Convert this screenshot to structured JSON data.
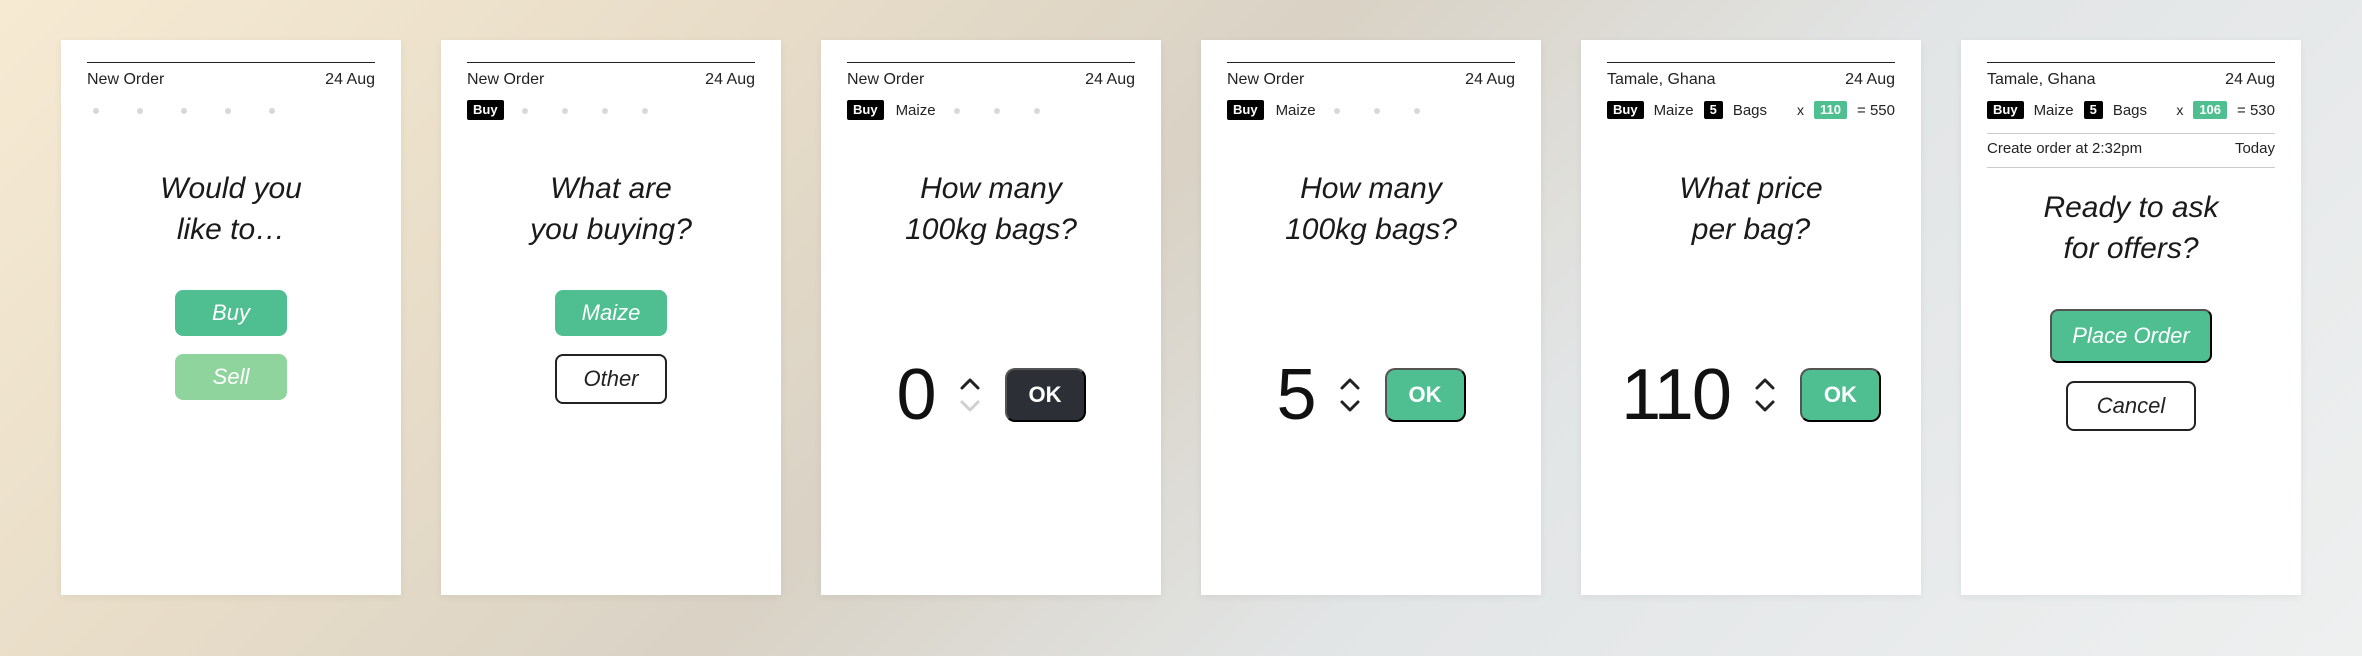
{
  "cards": [
    {
      "header_left": "New Order",
      "header_right": "24 Aug",
      "prompt_line1": "Would you",
      "prompt_line2": "like to…",
      "buy_label": "Buy",
      "sell_label": "Sell"
    },
    {
      "header_left": "New Order",
      "header_right": "24 Aug",
      "chip_buy": "Buy",
      "prompt_line1": "What are",
      "prompt_line2": "you buying?",
      "maize_label": "Maize",
      "other_label": "Other"
    },
    {
      "header_left": "New Order",
      "header_right": "24 Aug",
      "chip_buy": "Buy",
      "sub_product": "Maize",
      "prompt_line1": "How many",
      "prompt_line2": "100kg bags?",
      "value": "0",
      "ok_label": "OK"
    },
    {
      "header_left": "New Order",
      "header_right": "24 Aug",
      "chip_buy": "Buy",
      "sub_product": "Maize",
      "prompt_line1": "How many",
      "prompt_line2": "100kg bags?",
      "value": "5",
      "ok_label": "OK"
    },
    {
      "header_left": "Tamale, Ghana",
      "header_right": "24 Aug",
      "chip_buy": "Buy",
      "sub_product": "Maize",
      "chip_qty": "5",
      "sub_unit": "Bags",
      "mult": "x",
      "chip_price": "110",
      "eq": "= 550",
      "prompt_line1": "What price",
      "prompt_line2": "per bag?",
      "value": "110",
      "ok_label": "OK"
    },
    {
      "header_left": "Tamale, Ghana",
      "header_right": "24 Aug",
      "chip_buy": "Buy",
      "sub_product": "Maize",
      "chip_qty": "5",
      "sub_unit": "Bags",
      "mult": "x",
      "chip_price": "106",
      "eq": "= 530",
      "meta_left": "Create order at 2:32pm",
      "meta_right": "Today",
      "prompt_line1": "Ready to ask",
      "prompt_line2": "for offers?",
      "place_label": "Place Order",
      "cancel_label": "Cancel"
    }
  ]
}
